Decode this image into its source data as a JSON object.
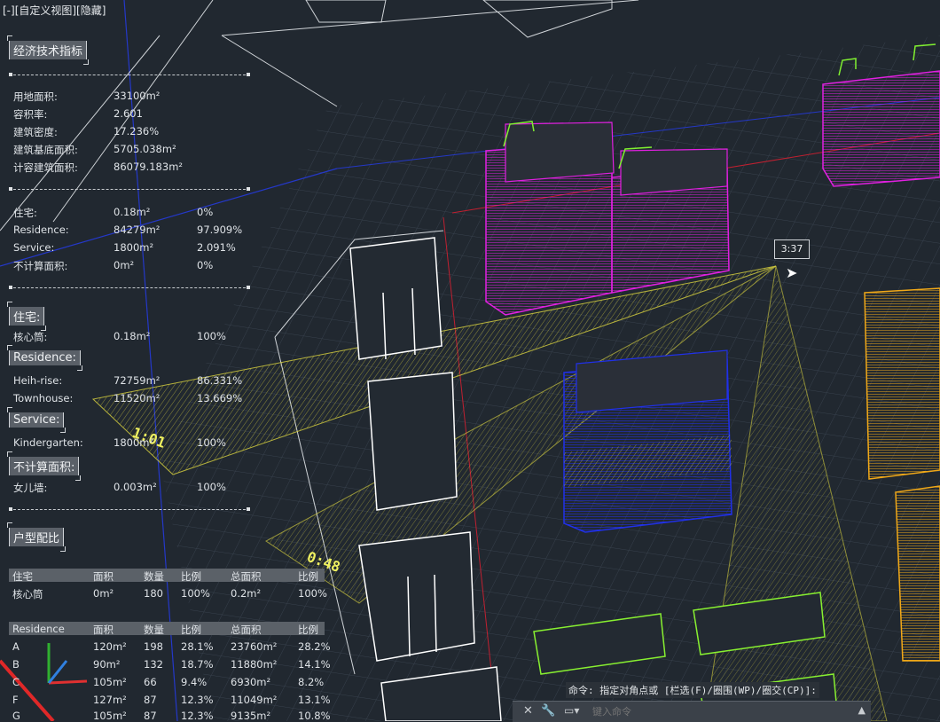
{
  "view_title": "[-][自定义视图][隐藏]",
  "time_label": "3:37",
  "annotations": [
    "1:01",
    "0:48"
  ],
  "section1": {
    "title": "经济技术指标",
    "rows": [
      {
        "label": "用地面积:",
        "value": "33100m²"
      },
      {
        "label": "容积率:",
        "value": "2.601"
      },
      {
        "label": "建筑密度:",
        "value": "17.236%"
      },
      {
        "label": "建筑基底面积:",
        "value": "5705.038m²"
      },
      {
        "label": "计容建筑面积:",
        "value": "86079.183m²"
      }
    ]
  },
  "section2": {
    "rows": [
      {
        "label": "住宅:",
        "value": "0.18m²",
        "pct": "0%"
      },
      {
        "label": "Residence:",
        "value": "84279m²",
        "pct": "97.909%"
      },
      {
        "label": "Service:",
        "value": "1800m²",
        "pct": "2.091%"
      },
      {
        "label": "不计算面积:",
        "value": "0m²",
        "pct": "0%"
      }
    ]
  },
  "zhuzhai": {
    "title": "住宅:",
    "rows": [
      {
        "label": "核心筒:",
        "value": "0.18m²",
        "pct": "100%"
      }
    ]
  },
  "residence": {
    "title": "Residence:",
    "rows": [
      {
        "label": "Heih-rise:",
        "value": "72759m²",
        "pct": "86.331%"
      },
      {
        "label": "Townhouse:",
        "value": "11520m²",
        "pct": "13.669%"
      }
    ]
  },
  "service": {
    "title": "Service:",
    "rows": [
      {
        "label": "Kindergarten:",
        "value": "1800m²",
        "pct": "100%"
      }
    ]
  },
  "bujisuan": {
    "title": "不计算面积:",
    "rows": [
      {
        "label": "女儿墙:",
        "value": "0.003m²",
        "pct": "100%"
      }
    ]
  },
  "unit_ratio": {
    "title": "户型配比"
  },
  "table1": {
    "headers": [
      "住宅",
      "面积",
      "数量",
      "比例",
      "总面积",
      "比例"
    ],
    "rows": [
      [
        "核心筒",
        "0m²",
        "180",
        "100%",
        "0.2m²",
        "100%"
      ]
    ]
  },
  "table2": {
    "headers": [
      "Residence",
      "面积",
      "数量",
      "比例",
      "总面积",
      "比例"
    ],
    "rows": [
      [
        "A",
        "120m²",
        "198",
        "28.1%",
        "23760m²",
        "28.2%"
      ],
      [
        "B",
        "90m²",
        "132",
        "18.7%",
        "11880m²",
        "14.1%"
      ],
      [
        "C",
        "105m²",
        "66",
        "9.4%",
        "6930m²",
        "8.2%"
      ],
      [
        "F",
        "127m²",
        "87",
        "12.3%",
        "11049m²",
        "13.1%"
      ],
      [
        "G",
        "105m²",
        "87",
        "12.3%",
        "9135m²",
        "10.8%"
      ]
    ]
  },
  "command": {
    "history": "命令: 指定对角点或 [栏选(F)/圈围(WP)/圈交(CP)]:",
    "placeholder": "键入命令"
  },
  "colors": {
    "background": "#212830",
    "magenta": "#e020e0",
    "blue": "#2030e8",
    "yellow": "#e8e040",
    "orange": "#f0a818",
    "green": "#88f030",
    "white": "#ffffff"
  },
  "icons": [
    "close-icon",
    "wrench-icon",
    "command-prompt-icon",
    "chevron-up-icon",
    "ucs-axis-icon",
    "cursor-arrow-icon"
  ]
}
